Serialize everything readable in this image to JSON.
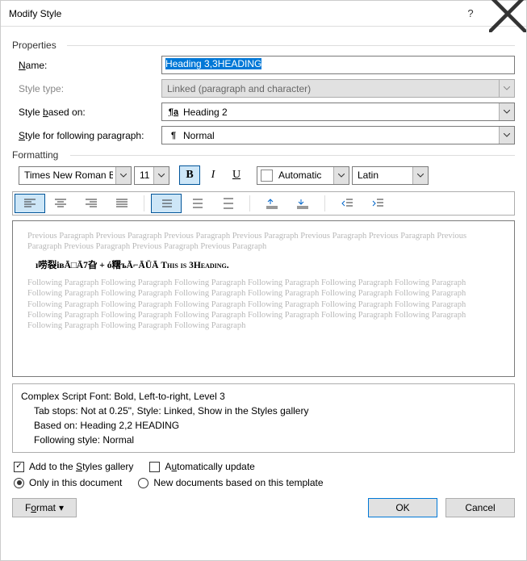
{
  "title": "Modify Style",
  "groups": {
    "properties": "Properties",
    "formatting": "Formatting"
  },
  "labels": {
    "name_pre": "",
    "name_key": "N",
    "name_post": "ame:",
    "styletype": "Style type:",
    "basedon_pre": "Style ",
    "basedon_key": "b",
    "basedon_post": "ased on:",
    "following_pre": "",
    "following_key": "S",
    "following_post": "tyle for following paragraph:"
  },
  "fields": {
    "name_value": "Heading 3,3HEADING",
    "styletype_value": "Linked (paragraph and character)",
    "basedon_value": "Heading 2",
    "following_value": "Normal"
  },
  "format_bar": {
    "font": "Times New Roman Bold",
    "size": "11",
    "bold": "B",
    "italic": "I",
    "underline": "U",
    "color": "Automatic",
    "lang": "Latin"
  },
  "preview": {
    "prev_text": "Previous Paragraph Previous Paragraph Previous Paragraph Previous Paragraph Previous Paragraph Previous Paragraph Previous Paragraph Previous Paragraph Previous Paragraph Previous Paragraph",
    "sample_garbled": "ı唠裂iʙĀ□Ā7旮 + ó糬ъĀ⌐ĀŪĀ ",
    "sample_caps": "This is 3Heading.",
    "follow_text": "Following Paragraph Following Paragraph Following Paragraph Following Paragraph Following Paragraph Following Paragraph Following Paragraph Following Paragraph Following Paragraph Following Paragraph Following Paragraph Following Paragraph Following Paragraph Following Paragraph Following Paragraph Following Paragraph Following Paragraph Following Paragraph Following Paragraph Following Paragraph Following Paragraph Following Paragraph Following Paragraph Following Paragraph Following Paragraph Following Paragraph Following Paragraph"
  },
  "description": {
    "line1": "Complex Script Font: Bold, Left-to-right, Level 3",
    "line2": "Tab stops: Not at  0.25\", Style: Linked, Show in the Styles gallery",
    "line3": "Based on: Heading 2,2 HEADING",
    "line4": "Following style: Normal"
  },
  "options": {
    "add_gallery_pre": "Add to the ",
    "add_gallery_key": "S",
    "add_gallery_post": "tyles gallery",
    "auto_update_pre": "A",
    "auto_update_key": "u",
    "auto_update_post": "tomatically update",
    "only_doc": "Only in this document",
    "new_docs": "New documents based on this template"
  },
  "buttons": {
    "format_pre": "F",
    "format_key": "o",
    "format_post": "rmat",
    "ok": "OK",
    "cancel": "Cancel"
  }
}
